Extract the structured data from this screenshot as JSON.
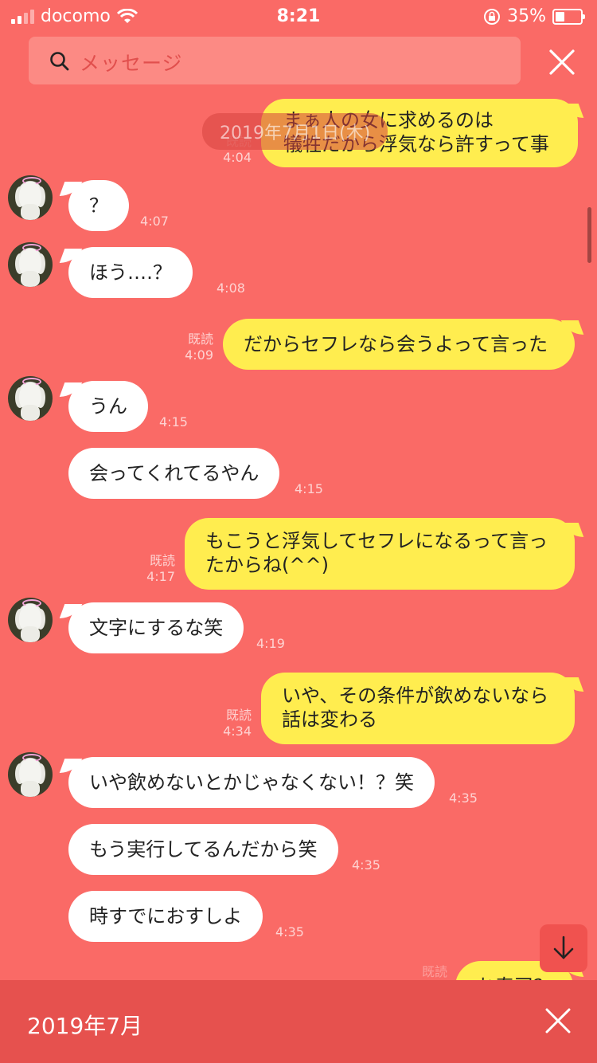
{
  "status": {
    "carrier": "docomo",
    "time": "8:21",
    "battery": "35%",
    "battery_level": 0.35,
    "icons": [
      "signal-icon",
      "wifi-icon",
      "rotation-lock-icon",
      "battery-icon"
    ]
  },
  "search": {
    "placeholder": "メッセージ",
    "icon": "search-icon"
  },
  "close_icon": "close-icon",
  "date_pill": "2019年7月1日(木)",
  "messages": [
    {
      "side": "out",
      "lines": [
        "まぁ人の女に求めるのは",
        "犠牲だから浮気なら許すって事"
      ],
      "time": "4:04",
      "read": "既読"
    },
    {
      "side": "in",
      "text": "？",
      "time": "4:07"
    },
    {
      "side": "in",
      "text": "ほう‥‥？",
      "time": "4:08"
    },
    {
      "side": "out",
      "text": "だからセフレなら会うよって言った",
      "time": "4:09",
      "read": "既読"
    },
    {
      "side": "in",
      "text": "うん",
      "time": "4:15"
    },
    {
      "side": "in",
      "text": "会ってくれてるやん",
      "time": "4:15"
    },
    {
      "side": "out",
      "lines": [
        "もこうと浮気してセフレになるって言っ",
        "たからね(^^)"
      ],
      "time": "4:17",
      "read": "既読"
    },
    {
      "side": "in",
      "text": "文字にするな笑",
      "time": "4:19"
    },
    {
      "side": "out",
      "lines": [
        "いや、その条件が飲めないなら",
        "話は変わる"
      ],
      "time": "4:34",
      "read": "既読"
    },
    {
      "side": "in",
      "text": "いや飲めないとかじゃなくない！？笑",
      "time": "4:35"
    },
    {
      "side": "in",
      "text": "もう実行してるんだから笑",
      "time": "4:35"
    },
    {
      "side": "in",
      "text": "時すでにおすしよ",
      "time": "4:35"
    },
    {
      "side": "out",
      "text": "お寿司？",
      "time": "",
      "read": "既読"
    }
  ],
  "bottom": {
    "label": "2019年7月",
    "close_icon": "close-icon"
  },
  "scroll_down_icon": "arrow-down-icon",
  "colors": {
    "background": "#fa6a66",
    "outgoing_bubble": "#ffed4f",
    "incoming_bubble": "#ffffff",
    "bottom_bar": "#e6514e"
  }
}
